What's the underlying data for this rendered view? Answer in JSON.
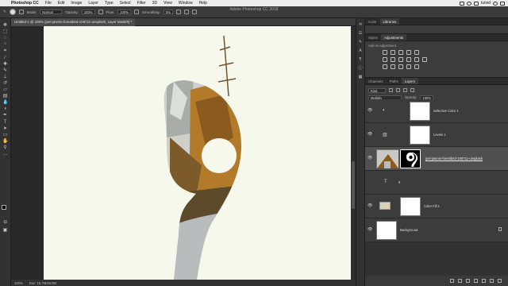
{
  "menubar": {
    "app_name": "Photoshop CC",
    "menus": [
      "File",
      "Edit",
      "Image",
      "Layer",
      "Type",
      "Select",
      "Filter",
      "3D",
      "View",
      "Window",
      "Help"
    ],
    "user": "tutvid"
  },
  "window_title": "Adobe Photoshop CC 2018",
  "options": {
    "mode_label": "Mode:",
    "mode_value": "Normal",
    "opacity_label": "Opacity:",
    "opacity_value": "100%",
    "flow_label": "Flow:",
    "flow_value": "100%",
    "smoothing_label": "Smoothing:",
    "smoothing_value": "0%"
  },
  "document": {
    "tab_title": "Untitled-1 @ 100% (joel-jasmin-forestbird-106711-unsplash, Layer Mask/8) *",
    "zoom": "100%",
    "doc_info": "Doc: 15.7M/48.0M"
  },
  "panels": {
    "top_tabs": [
      "Color",
      "Libraries"
    ],
    "top_active": "Libraries",
    "mid_tabs": [
      "Styles",
      "Adjustments"
    ],
    "mid_active": "Adjustments",
    "adjustments_label": "Add an adjustment",
    "layer_tabs": [
      "Channels",
      "Paths",
      "Layers"
    ],
    "layer_active": "Layers",
    "kind_label": "Kind",
    "blend_mode": "Multiply",
    "opacity_label": "Opacity:",
    "opacity_value": "100%",
    "lock_label": "Lock:",
    "fill_label": "Fill:",
    "fill_value": "100%"
  },
  "layers": [
    {
      "name": "Selective Color 1",
      "type": "adjustment"
    },
    {
      "name": "Levels 1",
      "type": "adjustment"
    },
    {
      "name": "joel-jasmin-forestbird-106711-unsplash",
      "type": "photo",
      "selected": true
    },
    {
      "name": "9",
      "type": "text"
    },
    {
      "name": "Color Fill 1",
      "type": "fill"
    },
    {
      "name": "Background",
      "type": "background",
      "locked": true
    }
  ],
  "colors": {
    "canvas_bg": "#f7f8ec",
    "foliage": "#b37a2a",
    "road": "#b9bcbc",
    "selected_layer": "#505050"
  },
  "icons": {
    "tools": [
      "move",
      "marquee",
      "lasso",
      "quick-select",
      "crop",
      "eyedropper",
      "healing",
      "brush",
      "clone-stamp",
      "history-brush",
      "eraser",
      "gradient",
      "blur",
      "dodge",
      "pen",
      "type",
      "path-select",
      "rectangle",
      "hand",
      "zoom",
      "more"
    ]
  }
}
